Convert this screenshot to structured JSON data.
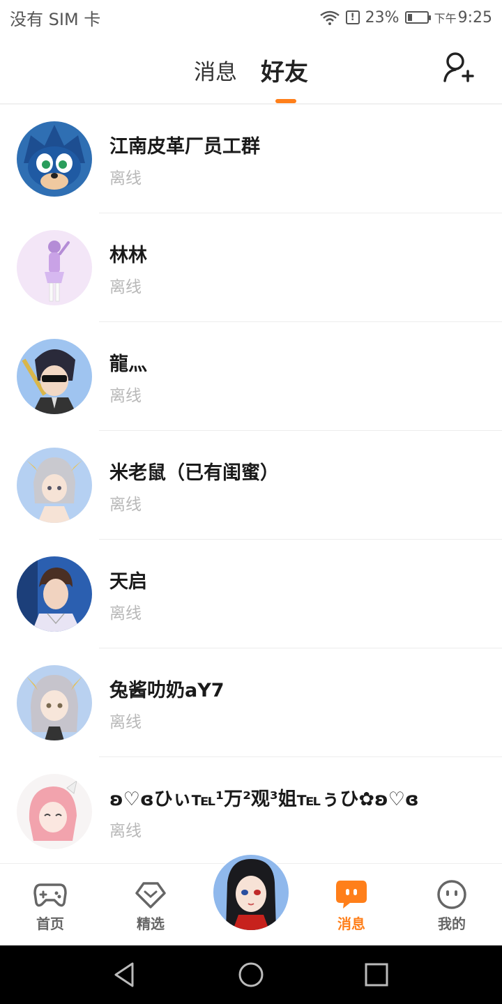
{
  "status_bar": {
    "carrier": "没有 SIM 卡",
    "battery_percent": "23%",
    "battery_level": 0.23,
    "ampm": "下午",
    "time": "9:25"
  },
  "header": {
    "tab_messages": "消息",
    "tab_friends": "好友",
    "active_tab": "好友",
    "add_friend_icon": "add-user-icon"
  },
  "friends": [
    {
      "name": "江南皮革厂员工群",
      "status": "离线"
    },
    {
      "name": "林林",
      "status": "离线"
    },
    {
      "name": "龍灬",
      "status": "离线"
    },
    {
      "name": "米老鼠（已有闺蜜）",
      "status": "离线"
    },
    {
      "name": "天启",
      "status": "离线"
    },
    {
      "name": "兔酱叻奶aY7",
      "status": "离线"
    },
    {
      "name": "ʚ♡ɞひぃ℡¹万²观³姐℡ぅひ✿ʚ♡ɞ",
      "status": "离线"
    }
  ],
  "bottom_nav": {
    "home": "首页",
    "featured": "精选",
    "messages": "消息",
    "mine": "我的",
    "active": "消息"
  },
  "colors": {
    "accent": "#ff7f1a",
    "offline_text": "#b8b8b8"
  }
}
